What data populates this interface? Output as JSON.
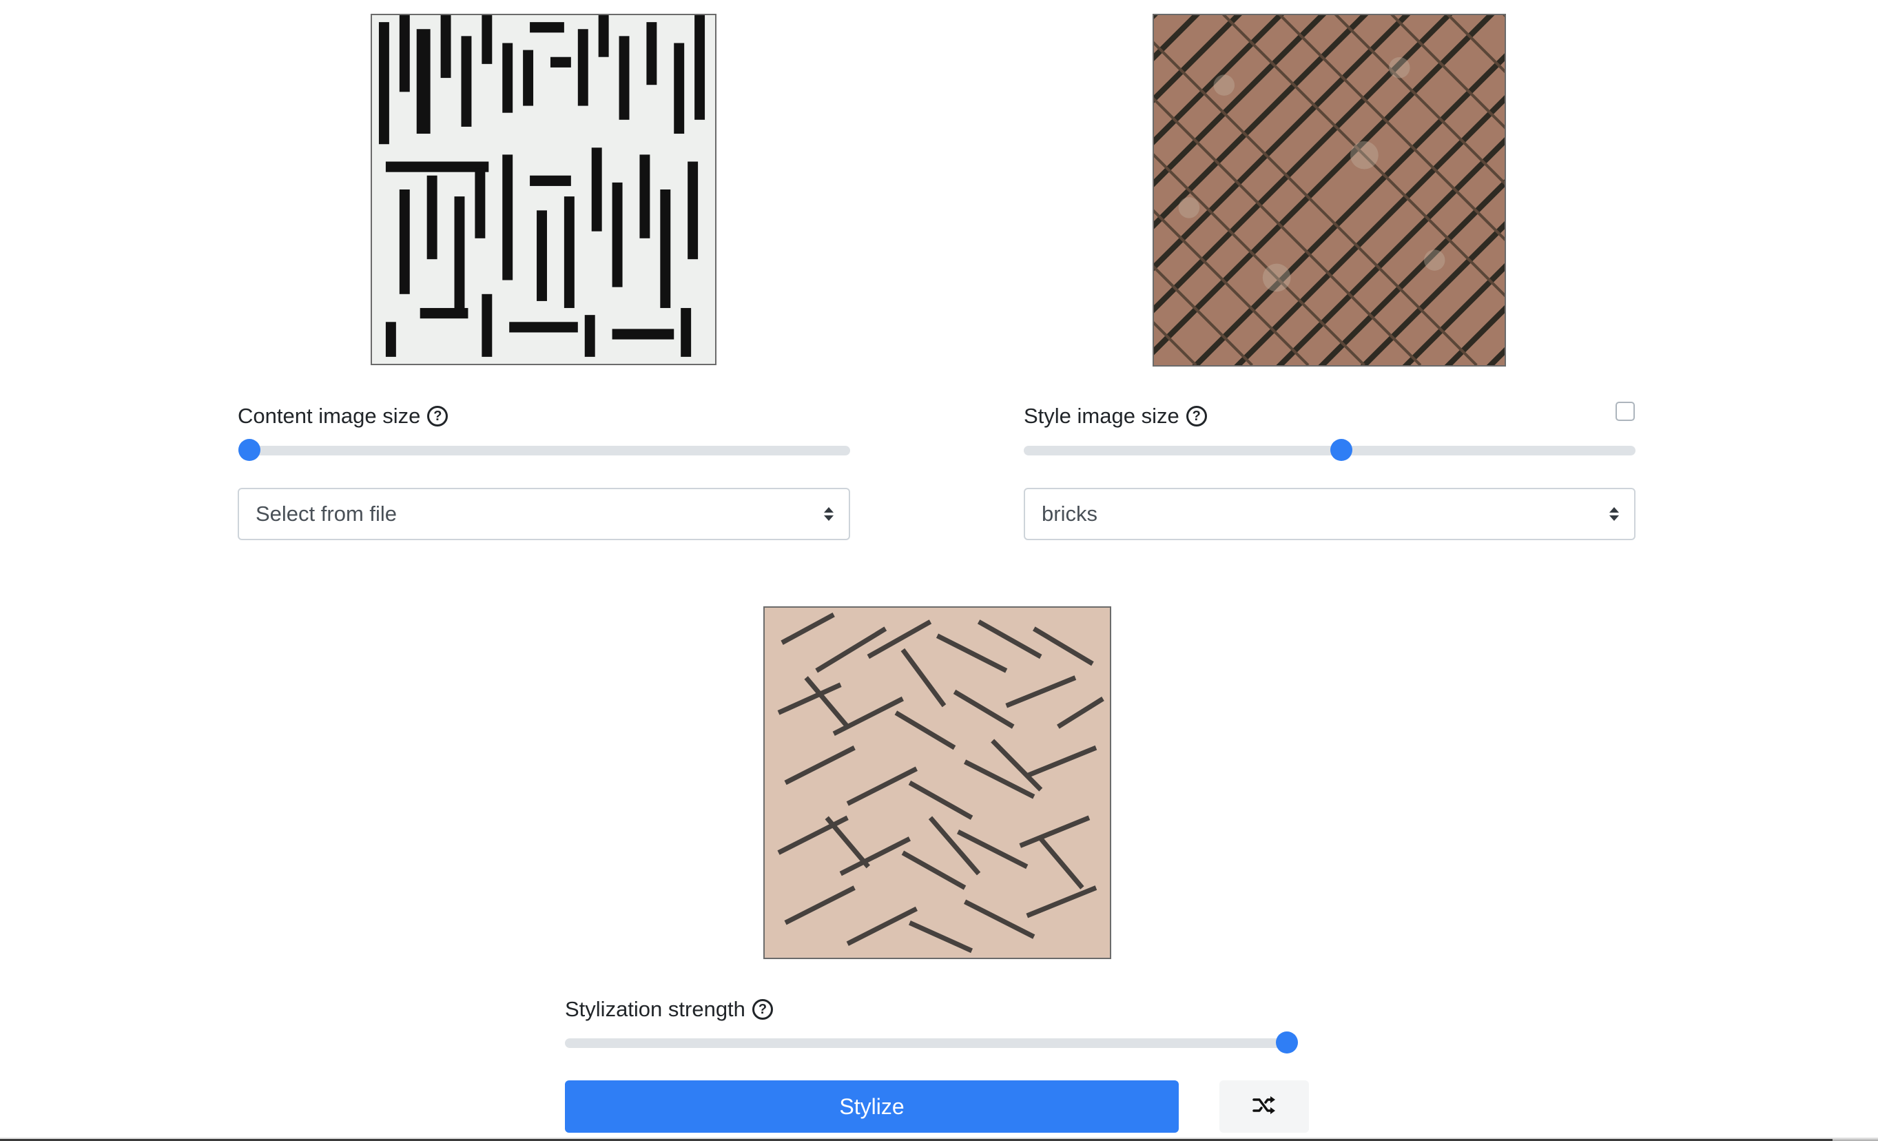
{
  "content_panel": {
    "label": "Content image size",
    "help_icon": "question-circle-icon",
    "slider_value": 0,
    "select_value": "Select from file"
  },
  "style_panel": {
    "label": "Style image size",
    "help_icon": "question-circle-icon",
    "slider_value": 0.52,
    "select_value": "bricks",
    "checkbox_checked": false
  },
  "stylized_panel": {
    "label": "Stylization strength",
    "help_icon": "question-circle-icon",
    "slider_value": 1.0
  },
  "actions": {
    "stylize_label": "Stylize",
    "randomize_icon": "shuffle-icon"
  },
  "colors": {
    "accent": "#2f7ef5",
    "track": "#dee2e6",
    "text": "#212529"
  }
}
